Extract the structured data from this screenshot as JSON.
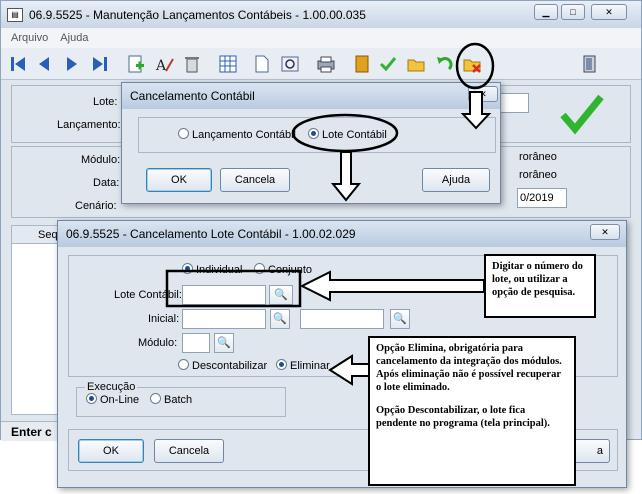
{
  "main_window": {
    "title": "06.9.5525 - Manutenção Lançamentos Contábeis - 1.00.00.035",
    "menu": [
      "Arquivo",
      "Ajuda"
    ],
    "labels": {
      "lote": "Lote:",
      "lancamento": "Lançamento:",
      "modulo": "Módulo:",
      "data": "Data:",
      "cenario": "Cenário:",
      "seq": "Seq",
      "extemporaneo_group": "rorâneo",
      "extemporaneo_option": "rorâneo"
    },
    "values": {
      "date_partial": "0/2019"
    },
    "status": "Enter c"
  },
  "dialog1": {
    "title": "Cancelamento Contábil",
    "options": [
      "Lançamento Contábil",
      "Lote Contábil"
    ],
    "selected": "Lote Contábil",
    "buttons": {
      "ok": "OK",
      "cancel": "Cancela",
      "help": "Ajuda"
    }
  },
  "dialog2": {
    "title": "06.9.5525 - Cancelamento Lote Contábil - 1.00.02.029",
    "mode_options": [
      "Individual",
      "Conjunto"
    ],
    "labels": {
      "lote_contabil": "Lote Contábil:",
      "inicial": "Inicial:",
      "modulo": "Módulo:"
    },
    "action_options": [
      "Descontabilizar",
      "Eliminar"
    ],
    "execucao": {
      "title": "Execução",
      "options": [
        "On-Line",
        "Batch"
      ]
    },
    "buttons": {
      "ok": "OK",
      "cancel": "Cancela",
      "extra": "a"
    }
  },
  "notes": {
    "note1": "Digitar o número do lote, ou utilizar a opção de pesquisa.",
    "note2_a": "Opção Elimina, obrigatória para cancelamento da integração dos módulos. Após eliminação não é possível recuperar o lote eliminado.",
    "note2_b": "Opção Descontabilizar, o lote fica pendente no programa (tela principal)."
  },
  "colors": {
    "accent_green": "#2fb52f",
    "annotation_red": "#d62b1f",
    "window_bg": "#dfe6ee"
  }
}
